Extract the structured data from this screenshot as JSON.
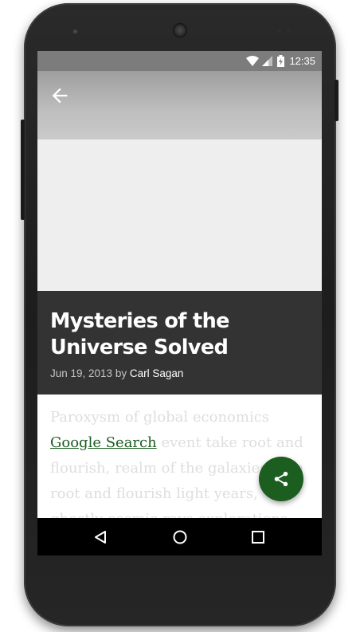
{
  "status_bar": {
    "time": "12:35",
    "icons": [
      "wifi-icon",
      "cell-signal-icon",
      "battery-charging-icon"
    ]
  },
  "toolbar": {
    "back_icon": "arrow-back-icon"
  },
  "article": {
    "title": "Mysteries of the Universe Solved",
    "date": "Jun 19, 2013",
    "by": "by",
    "author": "Carl Sagan",
    "body_intro": "Paroxysm of global economics",
    "link_text": "Google Search",
    "body_rest": "event take root and flourish, realm of the galaxies take root and flourish light years, ghostly cosmic rays explorations Tunguska event"
  },
  "fab": {
    "icon": "share-icon"
  },
  "nav_bar": {
    "icons": [
      "nav-back-icon",
      "nav-home-icon",
      "nav-recents-icon"
    ]
  },
  "colors": {
    "accent": "#1b5e20",
    "title_bg": "#333333",
    "toolbar_bg": "#bfbfbf",
    "hero_bg": "#eeeeee"
  }
}
